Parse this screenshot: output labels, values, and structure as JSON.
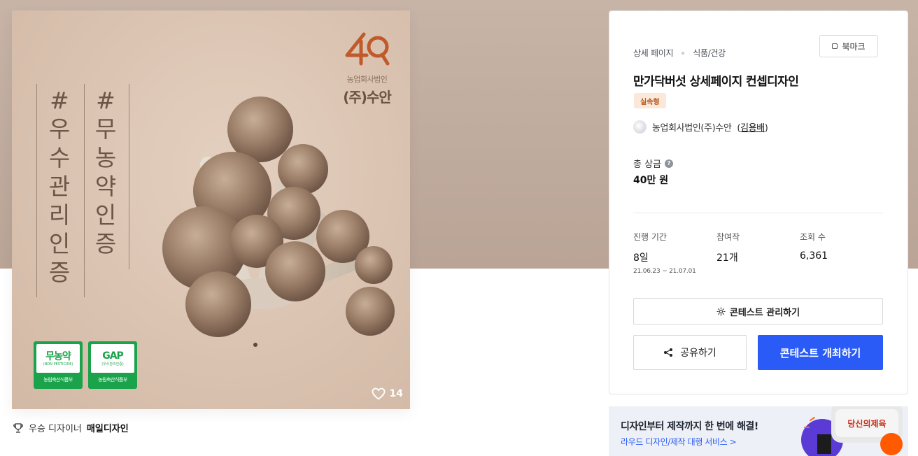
{
  "product": {
    "brand_sub": "농업회사법인",
    "brand_name": "(주)수안",
    "hashtag_a": [
      "#",
      "우",
      "수",
      "관",
      "리",
      "인",
      "증"
    ],
    "hashtag_b": [
      "#",
      "무",
      "농",
      "약",
      "인",
      "증"
    ],
    "cert_a": {
      "big": "무농약",
      "small": "(NON PESTICIDE)",
      "foot": "농림축산식품부"
    },
    "cert_b": {
      "big": "GAP",
      "small": "(우수관리인증)",
      "foot": "농림축산식품부"
    },
    "like_count": "14"
  },
  "winner": {
    "prefix": "우승 디자이너",
    "name": "매일디자인"
  },
  "info": {
    "breadcrumb": [
      "상세 페이지",
      "식품/건강"
    ],
    "bookmark_label": "북마크",
    "title": "만가닥버섯 상세페이지 컨셉디자인",
    "badge": "실속형",
    "org_name": "농업회사법인(주)수안",
    "org_person": "김용배",
    "prize_label": "총 상금",
    "prize_value": "40만 원",
    "stats": {
      "period": {
        "label": "진행 기간",
        "value": "8일",
        "sub": "21.06.23 ~ 21.07.01"
      },
      "entries": {
        "label": "참여작",
        "value": "21개"
      },
      "views": {
        "label": "조회 수",
        "value": "6,361"
      }
    },
    "manage_label": "콘테스트 관리하기",
    "share_label": "공유하기",
    "host_label": "콘테스트 개최하기"
  },
  "promo": {
    "title": "디자인부터 제작까지 한 번에 해결!",
    "link": "라우드 디자인/제작 대행 서비스 >",
    "sticker_text": "당신의제육"
  },
  "colors": {
    "primary": "#2a5bf6",
    "hero_bg": "#c0ab9d",
    "cert_green": "#1aa34a",
    "badge_bg": "#fbe8da"
  }
}
